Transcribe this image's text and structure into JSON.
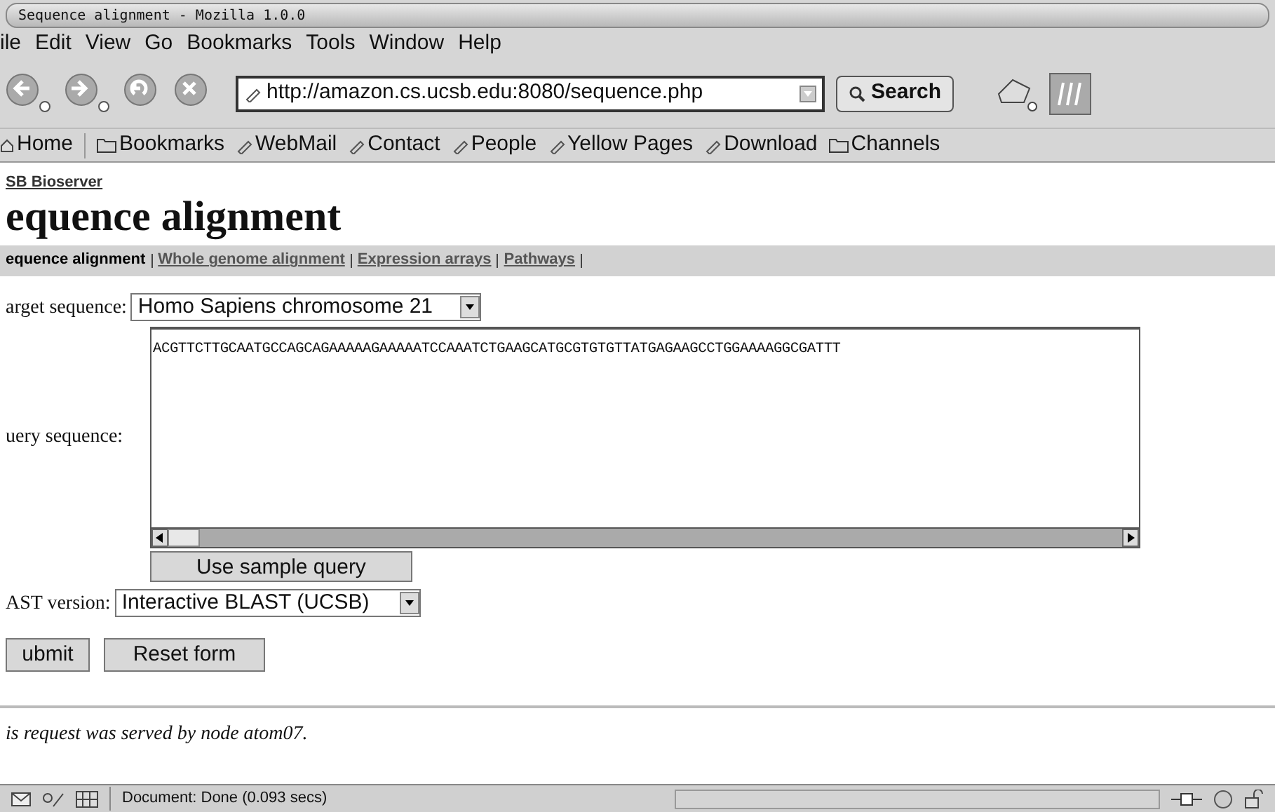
{
  "window": {
    "title": "Sequence alignment - Mozilla 1.0.0"
  },
  "menu": [
    "ile",
    "Edit",
    "View",
    "Go",
    "Bookmarks",
    "Tools",
    "Window",
    "Help"
  ],
  "toolbar": {
    "url": "http://amazon.cs.ucsb.edu:8080/sequence.php",
    "search_button": "Search"
  },
  "bookmarks": [
    {
      "kind": "home",
      "label": "Home"
    },
    {
      "kind": "folder",
      "label": "Bookmarks"
    },
    {
      "kind": "link",
      "label": "WebMail"
    },
    {
      "kind": "link",
      "label": "Contact"
    },
    {
      "kind": "link",
      "label": "People"
    },
    {
      "kind": "link",
      "label": "Yellow Pages"
    },
    {
      "kind": "link",
      "label": "Download"
    },
    {
      "kind": "folder",
      "label": "Channels"
    }
  ],
  "page": {
    "site_link": "SB Bioserver",
    "heading": "equence alignment",
    "nav": [
      {
        "label": "equence alignment",
        "selected": true
      },
      {
        "label": "Whole genome alignment",
        "selected": false
      },
      {
        "label": "Expression arrays",
        "selected": false
      },
      {
        "label": "Pathways",
        "selected": false
      }
    ],
    "target_label": "arget sequence:",
    "target_value": "Homo Sapiens chromosome 21",
    "query_label": "uery sequence:",
    "query_value": "ACGTTCTTGCAATGCCAGCAGAAAAAGAAAAATCCAAATCTGAAGCATGCGTGTGTTATGAGAAGCCTGGAAAAGGCGATTT",
    "sample_button": "Use sample query",
    "blast_label": "AST version:",
    "blast_value": "Interactive BLAST (UCSB)",
    "buttons": [
      "ubmit",
      "Reset form"
    ],
    "footer": "is request was served by node atom07."
  },
  "status_bar": {
    "text": "Document: Done (0.093 secs)"
  }
}
